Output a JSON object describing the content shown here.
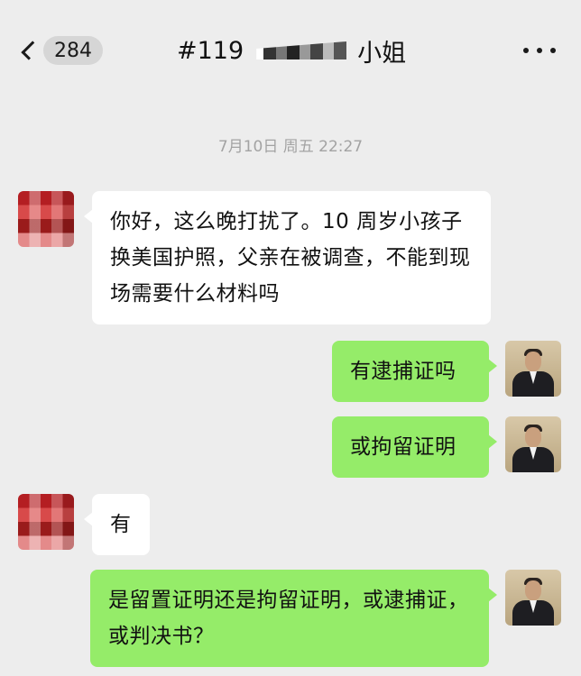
{
  "header": {
    "back_count": "284",
    "title_prefix": "#119",
    "title_suffix": "小姐"
  },
  "timestamp": "7月10日 周五 22:27",
  "messages": [
    {
      "side": "in",
      "text": "你好，这么晚打扰了。10 周岁小孩子换美国护照，父亲在被调查，不能到现场需要什么材料吗"
    },
    {
      "side": "out",
      "text": "有逮捕证吗"
    },
    {
      "side": "out",
      "text": "或拘留证明"
    },
    {
      "side": "in",
      "text": "有"
    },
    {
      "side": "out",
      "text": "是留置证明还是拘留证明，或逮捕证，或判决书？"
    }
  ],
  "colors": {
    "background": "#ededed",
    "incoming_bubble": "#ffffff",
    "outgoing_bubble": "#95ec69",
    "timestamp": "#a3a3a3"
  },
  "icons": {
    "back": "chevron-left-icon",
    "more": "more-dots-icon"
  }
}
